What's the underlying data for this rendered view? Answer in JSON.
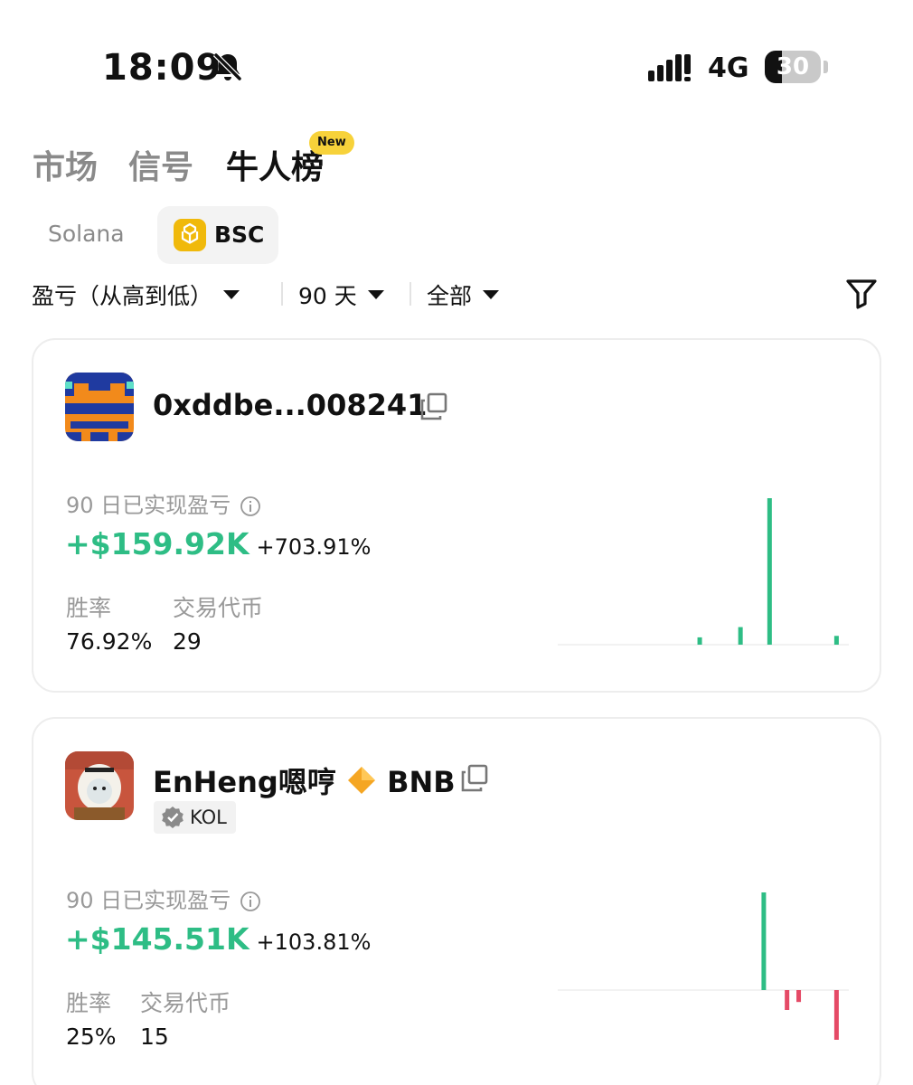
{
  "status_bar": {
    "time": "18:09",
    "network": "4G",
    "battery_level": "30",
    "battery_fraction": 0.3
  },
  "tabs": [
    {
      "label": "市场",
      "active": false
    },
    {
      "label": "信号",
      "active": false
    },
    {
      "label": "牛人榜",
      "active": true
    }
  ],
  "tab_badge": "New",
  "chains": [
    {
      "label": "Solana",
      "active": false
    },
    {
      "label": "BSC",
      "active": true
    }
  ],
  "filters": {
    "sort": "盈亏（从高到低）",
    "period": "90 天",
    "scope": "全部"
  },
  "colors": {
    "positive": "#2ebd85",
    "negative": "#e54a66",
    "badge": "#f7d23a",
    "bsc": "#f0b90b"
  },
  "icons": [
    "bell-off-icon",
    "signal-icon",
    "battery-icon",
    "bsc-logo-icon",
    "caret-down-icon",
    "filter-icon",
    "copy-icon",
    "info-icon",
    "verified-icon",
    "diamond-icon"
  ],
  "cards": [
    {
      "name": "0xddbe...008241",
      "pnl_label": "90 日已实现盈亏",
      "pnl_value": "+$159.92K",
      "pnl_percent": "+703.91%",
      "win_rate_label": "胜率",
      "win_rate": "76.92%",
      "tokens_label": "交易代币",
      "tokens": "29",
      "chart_bars": [
        {
          "pos": 0.48,
          "value": 0.05
        },
        {
          "pos": 0.62,
          "value": 0.12
        },
        {
          "pos": 0.72,
          "value": 1.0
        },
        {
          "pos": 0.95,
          "value": 0.06
        }
      ]
    },
    {
      "name": "EnHeng嗯哼",
      "name_suffix": "BNB",
      "tag": "KOL",
      "pnl_label": "90 日已实现盈亏",
      "pnl_value": "+$145.51K",
      "pnl_percent": "+103.81%",
      "win_rate_label": "胜率",
      "win_rate": "25%",
      "tokens_label": "交易代币",
      "tokens": "15",
      "chart_bars": [
        {
          "pos": 0.7,
          "value": 1.0
        },
        {
          "pos": 0.78,
          "value": -0.2
        },
        {
          "pos": 0.82,
          "value": -0.12
        },
        {
          "pos": 0.95,
          "value": -0.5
        }
      ]
    }
  ]
}
